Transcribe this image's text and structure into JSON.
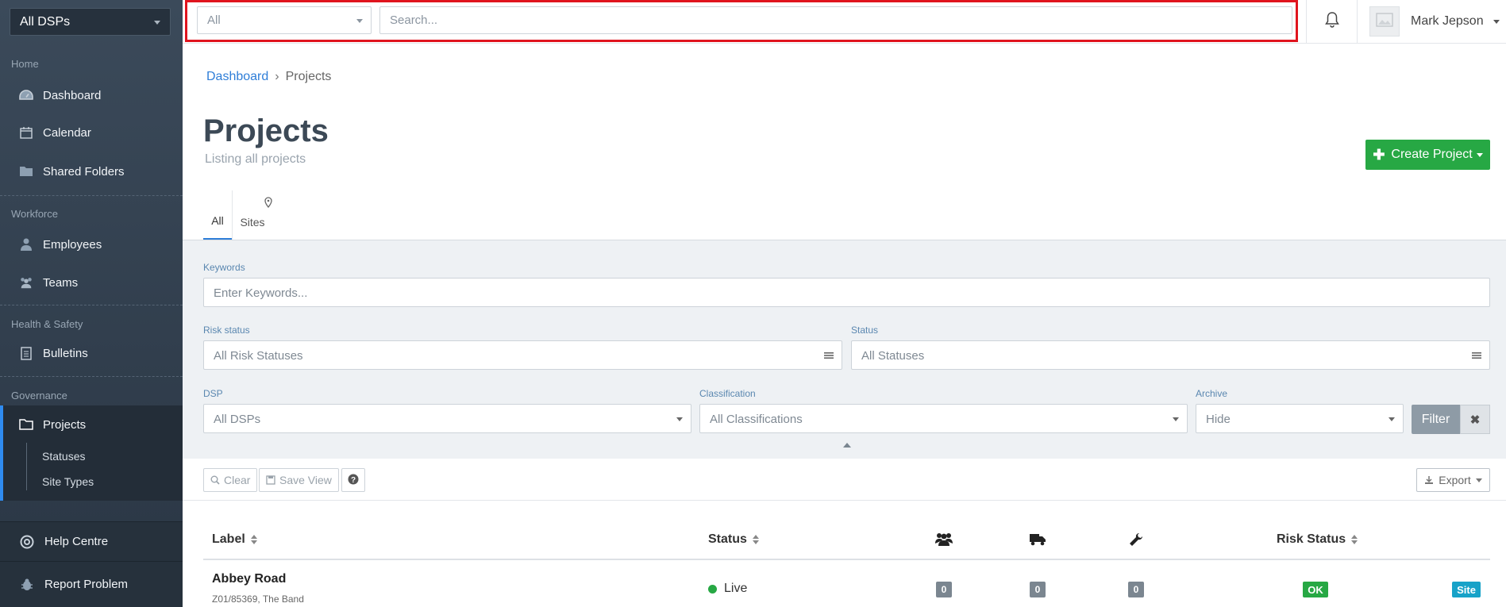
{
  "sidebar": {
    "dsp_select": "All DSPs",
    "sections": {
      "home": "Home",
      "workforce": "Workforce",
      "health_safety": "Health & Safety",
      "governance": "Governance"
    },
    "items": {
      "dashboard": "Dashboard",
      "calendar": "Calendar",
      "shared_folders": "Shared Folders",
      "employees": "Employees",
      "teams": "Teams",
      "bulletins": "Bulletins",
      "projects": "Projects",
      "statuses": "Statuses",
      "site_types": "Site Types"
    },
    "footer": {
      "help": "Help Centre",
      "report": "Report Problem"
    },
    "active_color": "#2f8bf0"
  },
  "topbar": {
    "type_select": "All",
    "search_placeholder": "Search...",
    "user_name": "Mark Jepson",
    "highlight_color": "#e0141e"
  },
  "breadcrumb": {
    "home": "Dashboard",
    "current": "Projects"
  },
  "page": {
    "title": "Projects",
    "subtitle": "Listing all projects",
    "create_button": "Create Project"
  },
  "tabs": {
    "all": "All",
    "sites": "Sites"
  },
  "filters": {
    "keywords_label": "Keywords",
    "keywords_placeholder": "Enter Keywords...",
    "risk_status_label": "Risk status",
    "risk_status_value": "All Risk Statuses",
    "status_label": "Status",
    "status_value": "All Statuses",
    "dsp_label": "DSP",
    "dsp_value": "All DSPs",
    "classification_label": "Classification",
    "classification_value": "All Classifications",
    "archive_label": "Archive",
    "archive_value": "Hide",
    "filter_button": "Filter"
  },
  "toolbar": {
    "clear": "Clear",
    "save_view": "Save View",
    "export": "Export"
  },
  "table": {
    "headers": {
      "label": "Label",
      "status": "Status",
      "risk_status": "Risk Status"
    },
    "rows": [
      {
        "label": "Abbey Road",
        "sub": "Z01/85369, The Band",
        "status": "Live",
        "employees": "0",
        "vehicles": "0",
        "tools": "0",
        "risk": "OK",
        "type": "Site"
      }
    ]
  }
}
